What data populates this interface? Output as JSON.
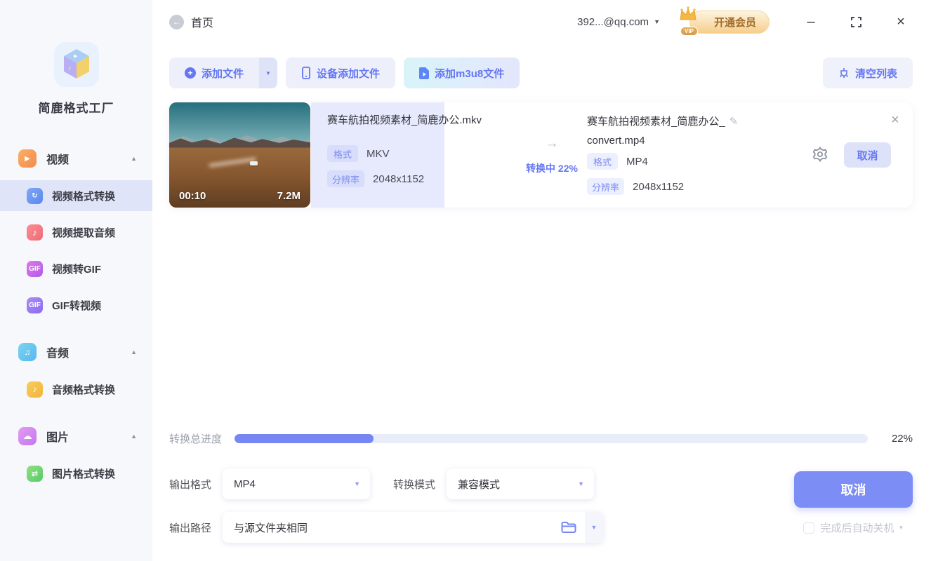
{
  "app": {
    "title": "简鹿格式工厂"
  },
  "titlebar": {
    "page_title": "首页",
    "account": "392...@qq.com",
    "vip_label": "开通会员",
    "vip_tag": "VIP"
  },
  "sidebar": {
    "items": [
      {
        "label": "视频",
        "type": "header",
        "icon": "video-icon"
      },
      {
        "label": "视频格式转换",
        "type": "sub",
        "icon": "video-convert-icon",
        "active": true
      },
      {
        "label": "视频提取音频",
        "type": "sub",
        "icon": "video-extract-audio-icon"
      },
      {
        "label": "视频转GIF",
        "type": "sub",
        "icon": "video-to-gif-icon"
      },
      {
        "label": "GIF转视频",
        "type": "sub",
        "icon": "gif-to-video-icon"
      },
      {
        "label": "音频",
        "type": "header",
        "icon": "audio-icon"
      },
      {
        "label": "音频格式转换",
        "type": "sub",
        "icon": "audio-convert-icon"
      },
      {
        "label": "图片",
        "type": "header",
        "icon": "image-icon"
      },
      {
        "label": "图片格式转换",
        "type": "sub",
        "icon": "image-convert-icon"
      }
    ]
  },
  "toolbar": {
    "add_file": "添加文件",
    "device_add_file": "设备添加文件",
    "add_m3u8": "添加m3u8文件",
    "clear_list": "清空列表"
  },
  "task": {
    "source": {
      "name": "赛车航拍视频素材_简鹿办公.mkv",
      "duration": "00:10",
      "size": "7.2M",
      "format_label": "格式",
      "format": "MKV",
      "resolution_label": "分辨率",
      "resolution": "2048x1152"
    },
    "status": {
      "text": "转换中 22%"
    },
    "output": {
      "name_line1": "赛车航拍视频素材_简鹿办公_",
      "name_line2": "convert.mp4",
      "format_label": "格式",
      "format": "MP4",
      "resolution_label": "分辨率",
      "resolution": "2048x1152"
    },
    "cancel_label": "取消"
  },
  "progress": {
    "label": "转换总进度",
    "percent": 22,
    "percent_label": "22%"
  },
  "settings": {
    "output_format_label": "输出格式",
    "output_format_value": "MP4",
    "convert_mode_label": "转换模式",
    "convert_mode_value": "兼容模式",
    "output_path_label": "输出路径",
    "output_path_value": "与源文件夹相同"
  },
  "actions": {
    "cancel_label": "取消",
    "shutdown_label": "完成后自动关机"
  },
  "colors": {
    "primary": "#6577F3",
    "progress_fill": "#7787F2",
    "active_item_bg": "#E0E4F8",
    "row_highlight": "#E7EAFC",
    "vip_text": "#A06B28"
  }
}
